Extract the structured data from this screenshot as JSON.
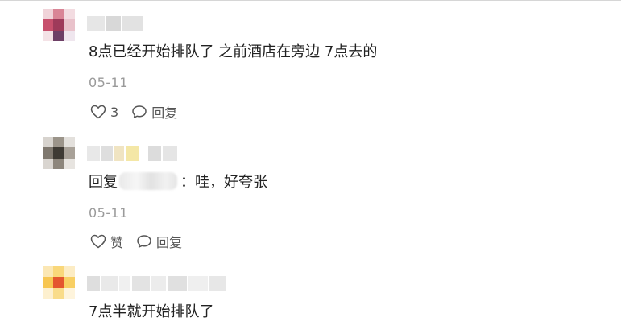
{
  "comments": [
    {
      "text": "8点已经开始排队了 之前酒店在旁边 7点去的",
      "date": "05-11",
      "like_label": "3",
      "reply_label": "回复",
      "like_icon": "heart-icon",
      "reply_icon": "comment-bubble-icon"
    },
    {
      "reply_prefix": "回复",
      "text": "：哇，好夸张",
      "date": "05-11",
      "like_label": "赞",
      "reply_label": "回复",
      "like_icon": "heart-icon",
      "reply_icon": "comment-bubble-icon"
    },
    {
      "text": "7点半就开始排队了"
    }
  ]
}
